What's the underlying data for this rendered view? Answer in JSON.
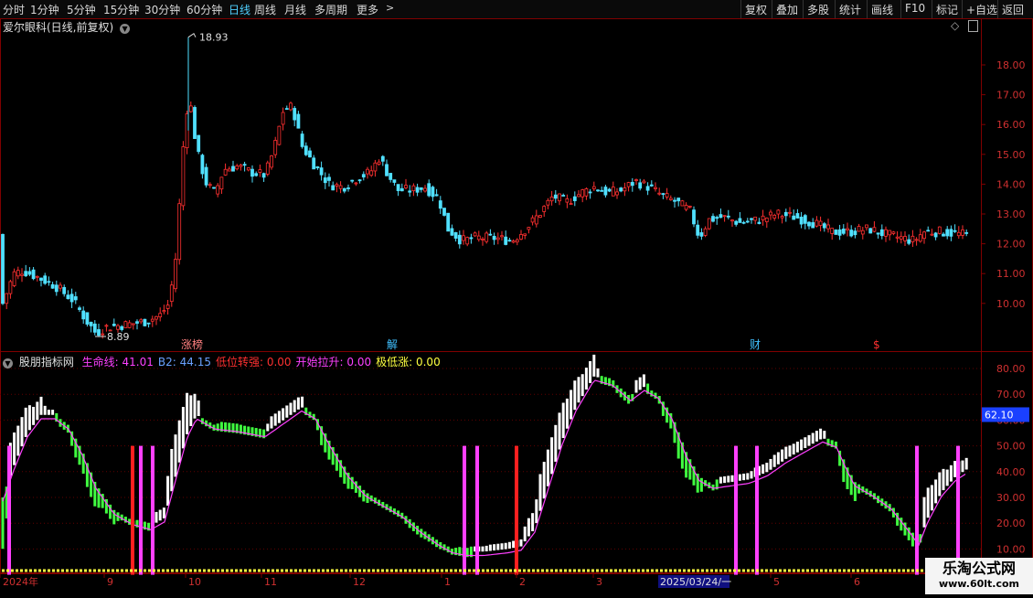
{
  "toolbar": {
    "periods": [
      "分时",
      "1分钟",
      "5分钟",
      "15分钟",
      "30分钟",
      "60分钟",
      "日线",
      "周线",
      "月线",
      "多周期",
      "更多"
    ],
    "active_period": "日线",
    "actions": [
      "复权",
      "叠加",
      "多股",
      "统计",
      "画线",
      "F10",
      "标记",
      "+自选",
      "返回"
    ]
  },
  "main_chart": {
    "stock_title": "爱尔眼科(日线,前复权)",
    "price_axis": [
      "18.00",
      "17.00",
      "16.00",
      "15.00",
      "14.00",
      "13.00",
      "12.00",
      "11.00",
      "10.00"
    ],
    "high_label": "18.93",
    "low_label": "8.89",
    "event_markers": [
      {
        "text": "涨榜",
        "color": "#ff8080"
      },
      {
        "text": "解",
        "color": "#40c0ff"
      },
      {
        "text": "财",
        "color": "#40c0ff"
      },
      {
        "text": "$",
        "color": "#ff3030"
      }
    ]
  },
  "indicator": {
    "name": "股朋指标网",
    "items": [
      {
        "label": "生命线: 41.01",
        "color": "#ff40ff"
      },
      {
        "label": "B2: 44.15",
        "color": "#6aa0ff"
      },
      {
        "label": "低位转强: 0.00",
        "color": "#ff3030"
      },
      {
        "label": "开始拉升: 0.00",
        "color": "#ff40ff"
      },
      {
        "label": "极低涨: 0.00",
        "color": "#ffff40"
      }
    ],
    "axis": [
      "80.00",
      "70.00",
      "60.00",
      "50.00",
      "40.00",
      "30.00",
      "20.00",
      "10.00"
    ],
    "current_value": "62.10"
  },
  "time_axis": [
    "2024年",
    "9",
    "10",
    "11",
    "12",
    "1",
    "2",
    "3",
    "2025/03/24/一",
    "5",
    "6"
  ],
  "watermark": {
    "line1": "乐淘公式网",
    "line2": "www.60lt.com"
  },
  "colors": {
    "up": "#ff3030",
    "down": "#50e0ff",
    "grid": "#800000",
    "life_line": "#ff40ff",
    "strong": "#40ff40"
  }
}
